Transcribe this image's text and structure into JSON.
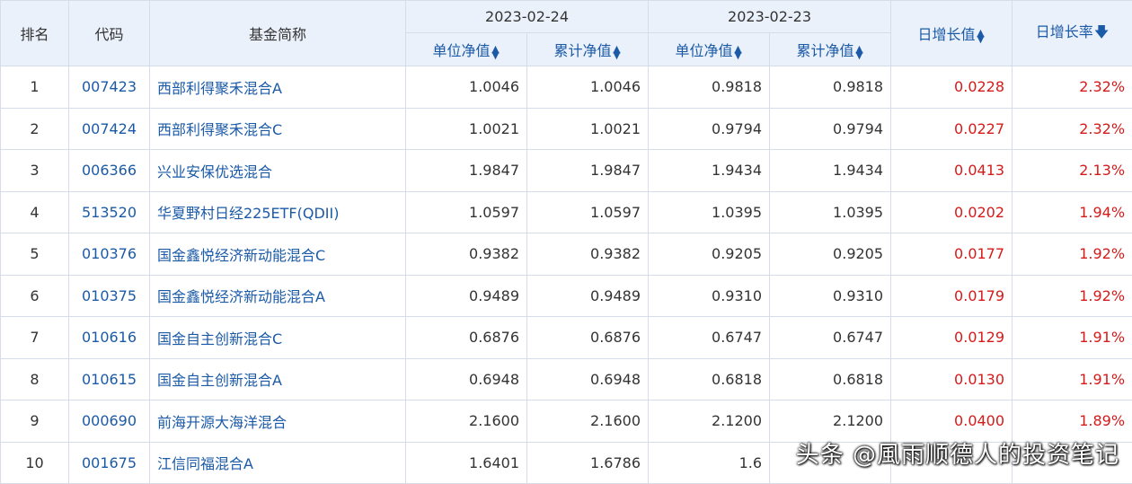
{
  "header": {
    "rank": "排名",
    "code": "代码",
    "name": "基金简称",
    "date1": "2023-02-24",
    "date2": "2023-02-23",
    "unit_nav": "单位净值",
    "cum_nav": "累计净值",
    "daily_change": "日增长值",
    "daily_rate": "日增长率"
  },
  "colors": {
    "header_bg": "#ebf1fa",
    "link": "#1b5aa7",
    "up": "#d61a1a",
    "border": "#d7dde8"
  },
  "rows": [
    {
      "rank": "1",
      "code": "007423",
      "name": "西部利得聚禾混合A",
      "u1": "1.0046",
      "c1": "1.0046",
      "u2": "0.9818",
      "c2": "0.9818",
      "chg": "0.0228",
      "rate": "2.32%"
    },
    {
      "rank": "2",
      "code": "007424",
      "name": "西部利得聚禾混合C",
      "u1": "1.0021",
      "c1": "1.0021",
      "u2": "0.9794",
      "c2": "0.9794",
      "chg": "0.0227",
      "rate": "2.32%"
    },
    {
      "rank": "3",
      "code": "006366",
      "name": "兴业安保优选混合",
      "u1": "1.9847",
      "c1": "1.9847",
      "u2": "1.9434",
      "c2": "1.9434",
      "chg": "0.0413",
      "rate": "2.13%"
    },
    {
      "rank": "4",
      "code": "513520",
      "name": "华夏野村日经225ETF(QDII)",
      "u1": "1.0597",
      "c1": "1.0597",
      "u2": "1.0395",
      "c2": "1.0395",
      "chg": "0.0202",
      "rate": "1.94%"
    },
    {
      "rank": "5",
      "code": "010376",
      "name": "国金鑫悦经济新动能混合C",
      "u1": "0.9382",
      "c1": "0.9382",
      "u2": "0.9205",
      "c2": "0.9205",
      "chg": "0.0177",
      "rate": "1.92%"
    },
    {
      "rank": "6",
      "code": "010375",
      "name": "国金鑫悦经济新动能混合A",
      "u1": "0.9489",
      "c1": "0.9489",
      "u2": "0.9310",
      "c2": "0.9310",
      "chg": "0.0179",
      "rate": "1.92%"
    },
    {
      "rank": "7",
      "code": "010616",
      "name": "国金自主创新混合C",
      "u1": "0.6876",
      "c1": "0.6876",
      "u2": "0.6747",
      "c2": "0.6747",
      "chg": "0.0129",
      "rate": "1.91%"
    },
    {
      "rank": "8",
      "code": "010615",
      "name": "国金自主创新混合A",
      "u1": "0.6948",
      "c1": "0.6948",
      "u2": "0.6818",
      "c2": "0.6818",
      "chg": "0.0130",
      "rate": "1.91%"
    },
    {
      "rank": "9",
      "code": "000690",
      "name": "前海开源大海洋混合",
      "u1": "2.1600",
      "c1": "2.1600",
      "u2": "2.1200",
      "c2": "2.1200",
      "chg": "0.0400",
      "rate": "1.89%"
    },
    {
      "rank": "10",
      "code": "001675",
      "name": "江信同福混合A",
      "u1": "1.6401",
      "c1": "1.6786",
      "u2": "1.6",
      "c2": "",
      "chg": "",
      "rate": ""
    }
  ],
  "watermark": "头条 @風雨顺德人的投资笔记"
}
